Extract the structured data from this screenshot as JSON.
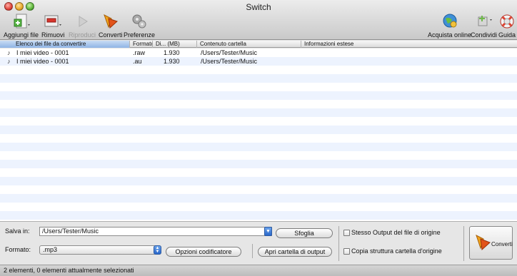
{
  "window": {
    "title": "Switch"
  },
  "toolbar": {
    "add_files": "Aggiungi file",
    "remove": "Rimuovi",
    "play": "Riproduci",
    "convert": "Converti",
    "preferences": "Preferenze",
    "buy_online": "Acquista online",
    "share": "Condividi",
    "help": "Guida"
  },
  "table": {
    "columns": [
      "Elenco dei file da convertire",
      "Formato",
      "Di... (MB)",
      "Contenuto cartella",
      "Informazioni estese"
    ],
    "rows": [
      {
        "name": "I miei video - 0001",
        "format": ".raw",
        "size": "1.930",
        "folder": "/Users/Tester/Music",
        "info": ""
      },
      {
        "name": "I miei video - 0001",
        "format": ".au",
        "size": "1.930",
        "folder": "/Users/Tester/Music",
        "info": ""
      }
    ]
  },
  "bottom": {
    "save_in_label": "Salva in:",
    "save_path": "/Users/Tester/Music",
    "browse": "Sfoglia",
    "format_label": "Formato:",
    "format_value": ".mp3",
    "encoder_options": "Opzioni codificatore",
    "open_output_folder": "Apri cartella di output",
    "same_output_label": "Stesso Output del file di origine",
    "copy_structure_label": "Copia struttura cartella d'origine",
    "convert_button": "Converti"
  },
  "status": {
    "text": "2 elementi, 0 elementi attualmente selezionati"
  },
  "colors": {
    "selection_blue": "#8fb4e5",
    "row_stripe": "#edf3fe"
  }
}
